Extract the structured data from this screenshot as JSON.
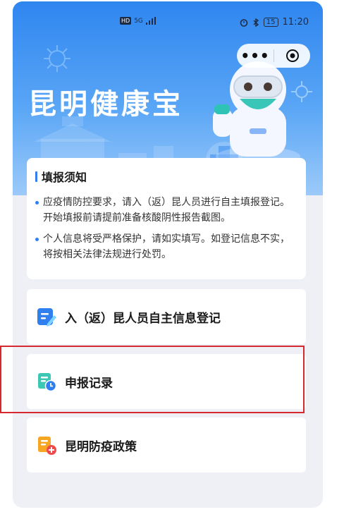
{
  "status_bar": {
    "hd": "HD",
    "signal": "5G",
    "battery": "15",
    "time": "11:20"
  },
  "capsule": {
    "more_label": "•••"
  },
  "header": {
    "title": "昆明健康宝"
  },
  "notice": {
    "title": "填报须知",
    "items": [
      "应疫情防控要求，请入（返）昆人员进行自主填报登记。开始填报前请提前准备核酸阴性报告截图。",
      "个人信息将受严格保护，请如实填写。如登记信息不实，将按相关法律法规进行处罚。"
    ]
  },
  "menu": [
    {
      "label": "入（返）昆人员自主信息登记",
      "icon": "edit-form-icon"
    },
    {
      "label": "申报记录",
      "icon": "record-clock-icon"
    },
    {
      "label": "昆明防疫政策",
      "icon": "policy-shield-icon"
    }
  ],
  "colors": {
    "accent": "#2f7ff0",
    "highlight": "#d8282f",
    "hero": "#2f86ef"
  }
}
